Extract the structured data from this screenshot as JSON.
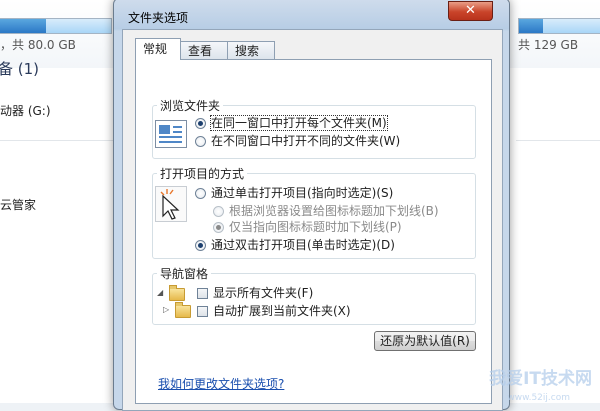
{
  "background": {
    "left_capacity": "，共 80.0 GB",
    "right_capacity": "共 129 GB",
    "section_heading": "备 (1)",
    "drive_label": "动器 (G:)",
    "app_label": "云管家"
  },
  "dialog": {
    "title": "文件夹选项",
    "close_glyph": "✕",
    "tabs": [
      "常规",
      "查看",
      "搜索"
    ],
    "browse_group": {
      "label": "浏览文件夹",
      "options": [
        "在同一窗口中打开每个文件夹(M)",
        "在不同窗口中打开不同的文件夹(W)"
      ],
      "selected": 0
    },
    "open_group": {
      "label": "打开项目的方式",
      "single_click": "通过单击打开项目(指向时选定)(S)",
      "underline_browser": "根据浏览器设置给图标标题加下划线(B)",
      "underline_hover": "仅当指向图标标题时加下划线(P)",
      "double_click": "通过双击打开项目(单击时选定)(D)"
    },
    "nav_group": {
      "label": "导航窗格",
      "show_all": "显示所有文件夹(F)",
      "auto_expand": "自动扩展到当前文件夹(X)"
    },
    "restore_button": "还原为默认值(R)",
    "help_link": "我如何更改文件夹选项?"
  },
  "watermark": {
    "main": "我爱IT技术网",
    "sub": "www.52ij.com"
  },
  "colors": {
    "accent": "#2b78c6",
    "link": "#1a4fae",
    "close": "#c9442a"
  }
}
